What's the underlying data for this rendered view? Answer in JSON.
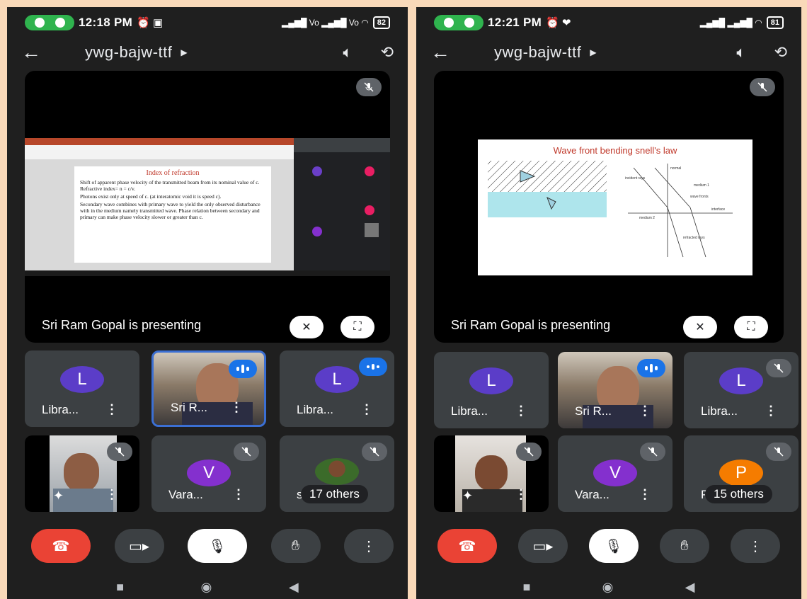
{
  "left": {
    "status": {
      "time": "12:18 PM",
      "icons": "⏰ ▣",
      "battery": "82",
      "signal": "Vo WiFi Vo WiFi"
    },
    "header": {
      "title": "ywg-bajw-ttf"
    },
    "stage": {
      "presenter": "Sri Ram Gopal is presenting",
      "slide_title": "Index of refraction",
      "slide_bullets": [
        "Shift of apparent phase velocity of the transmitted beam from its nominal value of c. Refractive index= n = c/v.",
        "Photons exist only at speed of c. (at interatomic void it is speed c).",
        "Secondary wave combines with primary wave to yield the only observed disturbance with in the medium namely transmitted wave. Phase relation between secondary and primary can make phase velocity slower or greater than c."
      ]
    },
    "tiles": [
      {
        "name": "Libra...",
        "initial": "L",
        "color": "#5b3dc8"
      },
      {
        "name": "Sri R...",
        "initial": ""
      },
      {
        "name": "Libra...",
        "initial": "L",
        "color": "#5b3dc8"
      },
      {
        "name": "",
        "initial": ""
      },
      {
        "name": "Vara...",
        "initial": "V",
        "color": "#8430ce"
      },
      {
        "name": "sr",
        "others": "17 others"
      }
    ]
  },
  "right": {
    "status": {
      "time": "12:21 PM",
      "icons": "⏰ ❤",
      "battery": "81"
    },
    "header": {
      "title": "ywg-bajw-ttf"
    },
    "stage": {
      "presenter": "Sri Ram Gopal is presenting",
      "slide_title": "Wave front bending snell's law",
      "labels": [
        "incident rays",
        "normal",
        "medium 1",
        "wave fronts",
        "interface",
        "medium 2",
        "refracted rays"
      ]
    },
    "tiles": [
      {
        "name": "Libra...",
        "initial": "L",
        "color": "#5b3dc8"
      },
      {
        "name": "Sri R...",
        "initial": ""
      },
      {
        "name": "Libra...",
        "initial": "L",
        "color": "#5b3dc8"
      },
      {
        "name": "",
        "initial": ""
      },
      {
        "name": "Vara...",
        "initial": "V",
        "color": "#8430ce"
      },
      {
        "name": "P",
        "initial": "P",
        "color": "#f57c00",
        "others": "15 others"
      }
    ]
  }
}
